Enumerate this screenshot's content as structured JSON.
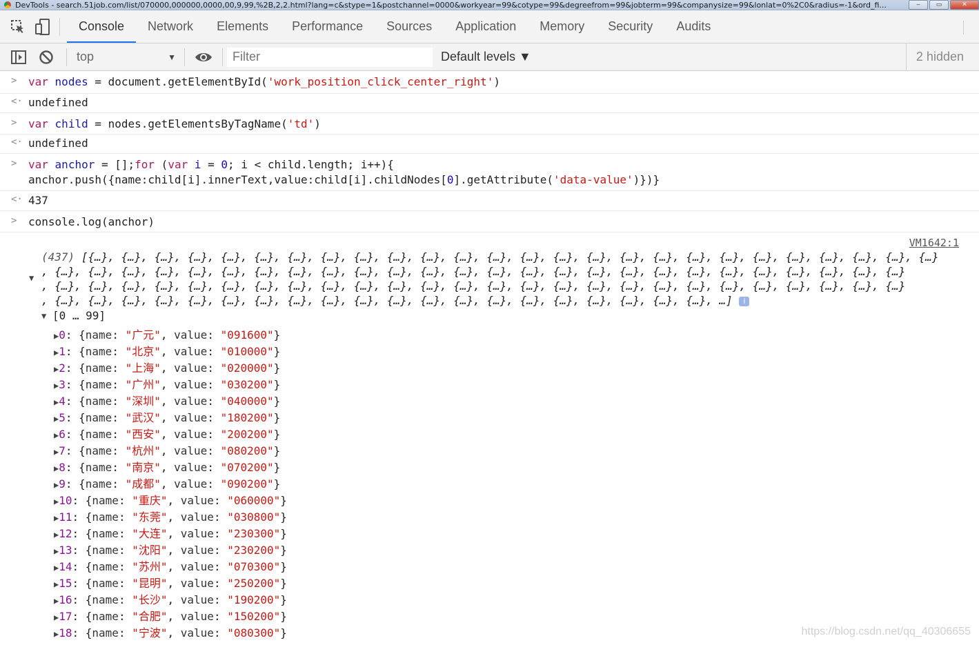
{
  "window": {
    "title": "DevTools - search.51job.com/list/070000,000000,0000,00,9,99,%2B,2,2.html?lang=c&stype=1&postchannel=0000&workyear=99&cotype=99&degreefrom=99&jobterm=99&companysize=99&lonlat=0%2C0&radius=-1&ord_fi..."
  },
  "tabs": [
    "Console",
    "Network",
    "Elements",
    "Performance",
    "Sources",
    "Application",
    "Memory",
    "Security",
    "Audits"
  ],
  "active_tab": "Console",
  "toolbar": {
    "context": "top",
    "filter_placeholder": "Filter",
    "levels": "Default levels ▼",
    "hidden": "2 hidden"
  },
  "console": {
    "cmd1": {
      "a": "var",
      "b": "nodes",
      "c": " = document.getElementById(",
      "d": "'work_position_click_center_right'",
      "e": ")"
    },
    "res1": "undefined",
    "cmd2": {
      "a": "var",
      "b": "child",
      "c": " = nodes.getElementsByTagName(",
      "d": "'td'",
      "e": ")"
    },
    "res2": "undefined",
    "cmd3_line1": {
      "a": "var",
      "b": "anchor",
      "c": " = [];",
      "d": "for",
      "e": " (",
      "f": "var",
      "g": "i",
      "h": " = ",
      "i": "0",
      "j": "; i < child.length; i++){"
    },
    "cmd3_line2": {
      "a": "anchor.push({name:child[i].innerText,value:child[i].childNodes[",
      "b": "0",
      "c": "].getAttribute(",
      "d": "'data-value'",
      "e": ")})}"
    },
    "res3": "437",
    "cmd4": "console.log(anchor)",
    "vm_link": "VM1642:1",
    "array_len": "(437)",
    "array_row1": "[{…}, {…}, {…}, {…}, {…}, {…}, {…}, {…}, {…}, {…}, {…}, {…}, {…}, {…}, {…}, {…}, {…}, {…}, {…}, {…}, {…}, {…}, {…}, {…}, {…}, {…}",
    "array_row2": ", {…}, {…}, {…}, {…}, {…}, {…}, {…}, {…}, {…}, {…}, {…}, {…}, {…}, {…}, {…}, {…}, {…}, {…}, {…}, {…}, {…}, {…}, {…}, {…}, {…}, {…}",
    "array_row3": ", {…}, {…}, {…}, {…}, {…}, {…}, {…}, {…}, {…}, {…}, {…}, {…}, {…}, {…}, {…}, {…}, {…}, {…}, {…}, {…}, {…}, {…}, {…}, {…}, {…}, {…}",
    "array_row4": ", {…}, {…}, {…}, {…}, {…}, {…}, {…}, {…}, {…}, {…}, {…}, {…}, {…}, {…}, {…}, {…}, {…}, {…}, {…}, {…}, …]",
    "info_badge": "i",
    "range_label": "[0 … 99]",
    "items": [
      {
        "idx": "0",
        "name": "广元",
        "value": "091600"
      },
      {
        "idx": "1",
        "name": "北京",
        "value": "010000"
      },
      {
        "idx": "2",
        "name": "上海",
        "value": "020000"
      },
      {
        "idx": "3",
        "name": "广州",
        "value": "030200"
      },
      {
        "idx": "4",
        "name": "深圳",
        "value": "040000"
      },
      {
        "idx": "5",
        "name": "武汉",
        "value": "180200"
      },
      {
        "idx": "6",
        "name": "西安",
        "value": "200200"
      },
      {
        "idx": "7",
        "name": "杭州",
        "value": "080200"
      },
      {
        "idx": "8",
        "name": "南京",
        "value": "070200"
      },
      {
        "idx": "9",
        "name": "成都",
        "value": "090200"
      },
      {
        "idx": "10",
        "name": "重庆",
        "value": "060000"
      },
      {
        "idx": "11",
        "name": "东莞",
        "value": "030800"
      },
      {
        "idx": "12",
        "name": "大连",
        "value": "230300"
      },
      {
        "idx": "13",
        "name": "沈阳",
        "value": "230200"
      },
      {
        "idx": "14",
        "name": "苏州",
        "value": "070300"
      },
      {
        "idx": "15",
        "name": "昆明",
        "value": "250200"
      },
      {
        "idx": "16",
        "name": "长沙",
        "value": "190200"
      },
      {
        "idx": "17",
        "name": "合肥",
        "value": "150200"
      },
      {
        "idx": "18",
        "name": "宁波",
        "value": "080300"
      }
    ],
    "prop_name": "name",
    "prop_value": "value"
  },
  "watermark": "https://blog.csdn.net/qq_40306655"
}
